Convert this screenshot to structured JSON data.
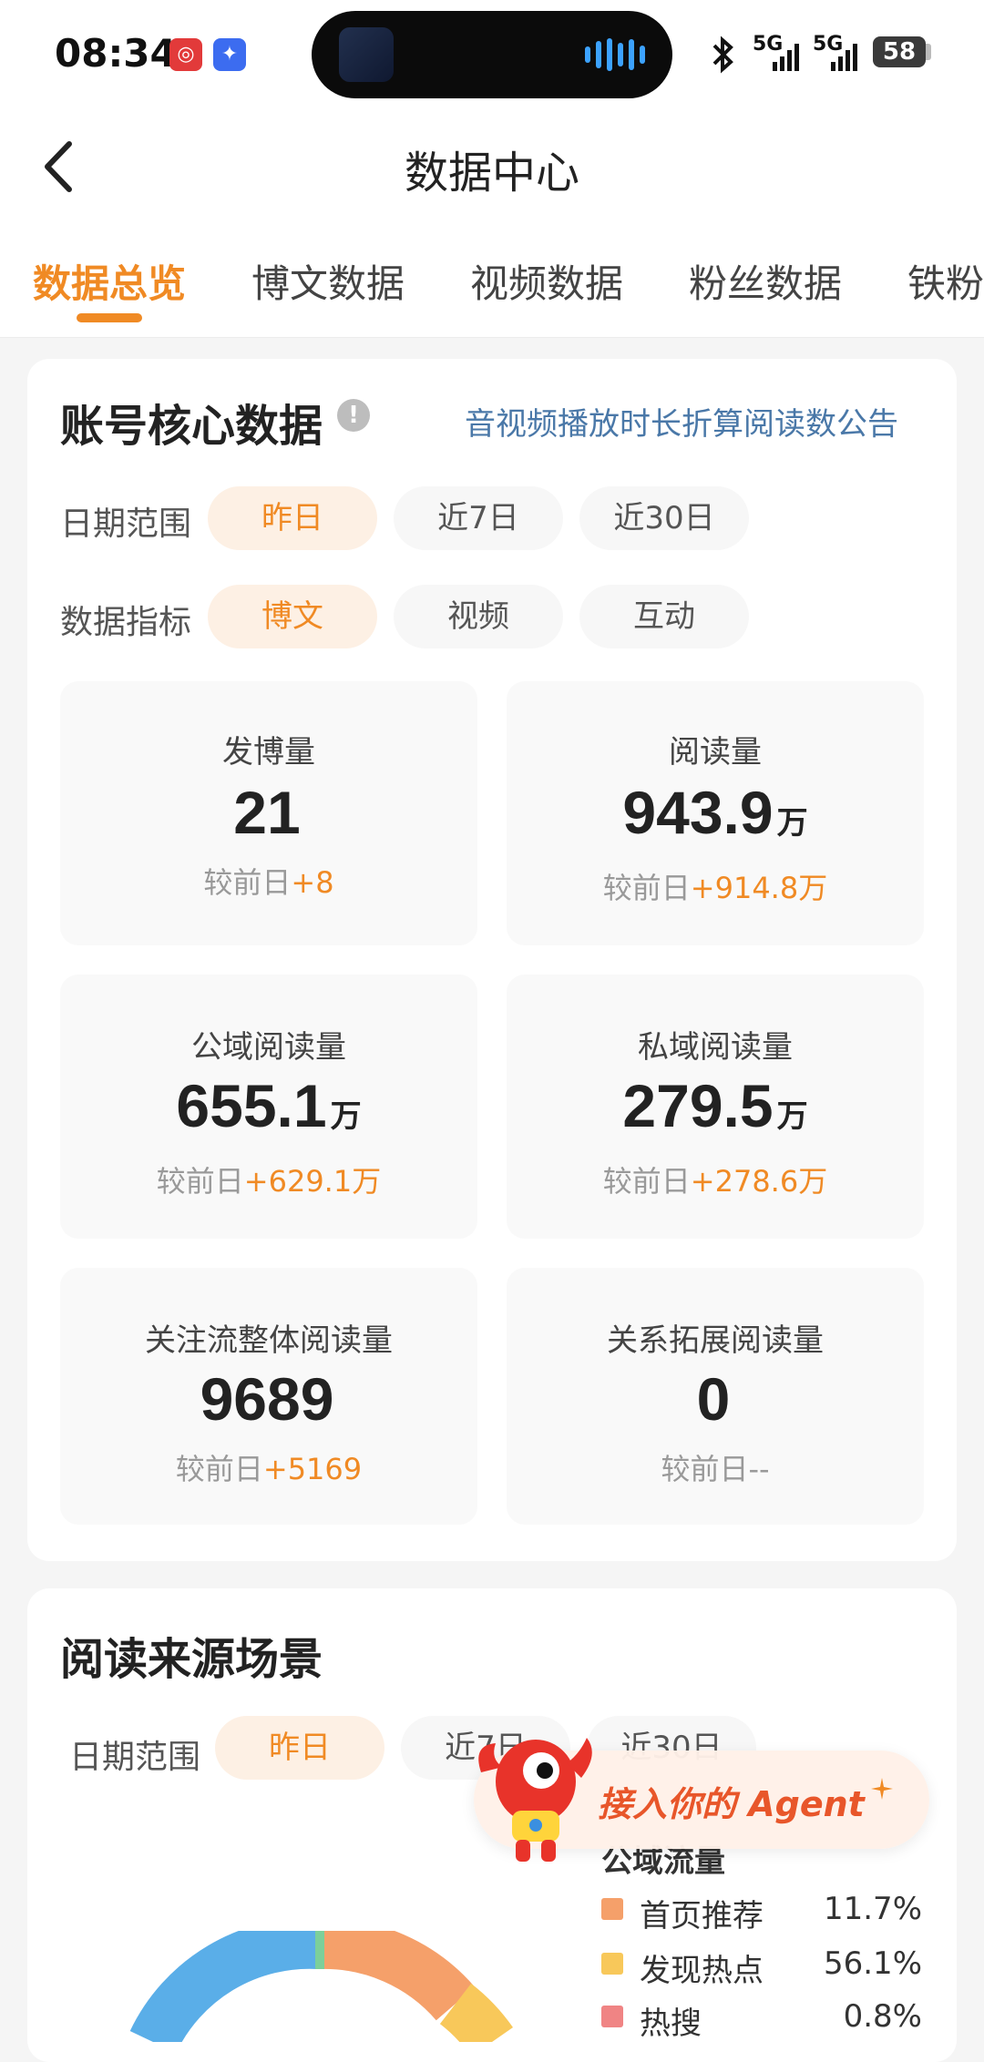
{
  "status_bar": {
    "time": "08:34",
    "net1": "5G",
    "net2": "5G",
    "battery": "58"
  },
  "header": {
    "title": "数据中心"
  },
  "tabs": [
    {
      "label": "数据总览",
      "active": true
    },
    {
      "label": "博文数据",
      "active": false
    },
    {
      "label": "视频数据",
      "active": false
    },
    {
      "label": "粉丝数据",
      "active": false
    },
    {
      "label": "铁粉",
      "active": false
    }
  ],
  "core": {
    "title": "账号核心数据",
    "notice_link": "音视频播放时长折算阅读数公告",
    "date_label": "日期范围",
    "date_chips": [
      "昨日",
      "近7日",
      "近30日"
    ],
    "metric_label": "数据指标",
    "metric_chips": [
      "博文",
      "视频",
      "互动"
    ],
    "compare_prefix": "较前日",
    "stats": [
      {
        "name": "发博量",
        "value": "21",
        "unit": "",
        "delta": "+8"
      },
      {
        "name": "阅读量",
        "value": "943.9",
        "unit": "万",
        "delta": "+914.8万"
      },
      {
        "name": "公域阅读量",
        "value": "655.1",
        "unit": "万",
        "delta": "+629.1万"
      },
      {
        "name": "私域阅读量",
        "value": "279.5",
        "unit": "万",
        "delta": "+278.6万"
      },
      {
        "name": "关注流整体阅读量",
        "value": "9689",
        "unit": "",
        "delta": "+5169"
      },
      {
        "name": "关系拓展阅读量",
        "value": "0",
        "unit": "",
        "delta": "--"
      }
    ]
  },
  "source": {
    "title": "阅读来源场景",
    "date_label": "日期范围",
    "date_chips": [
      "昨日",
      "近7日",
      "近30日"
    ],
    "legend_title": "公域流量",
    "legend": [
      {
        "name": "首页推荐",
        "pct": "11.7%",
        "color": "#f5a06a"
      },
      {
        "name": "发现热点",
        "pct": "56.1%",
        "color": "#f8c85a"
      },
      {
        "name": "热搜",
        "pct": "0.8%",
        "color": "#f08484"
      }
    ]
  },
  "agent": {
    "label": "接入你的 Agent"
  },
  "colors": {
    "accent": "#f08a24",
    "link": "#4a78a8"
  }
}
